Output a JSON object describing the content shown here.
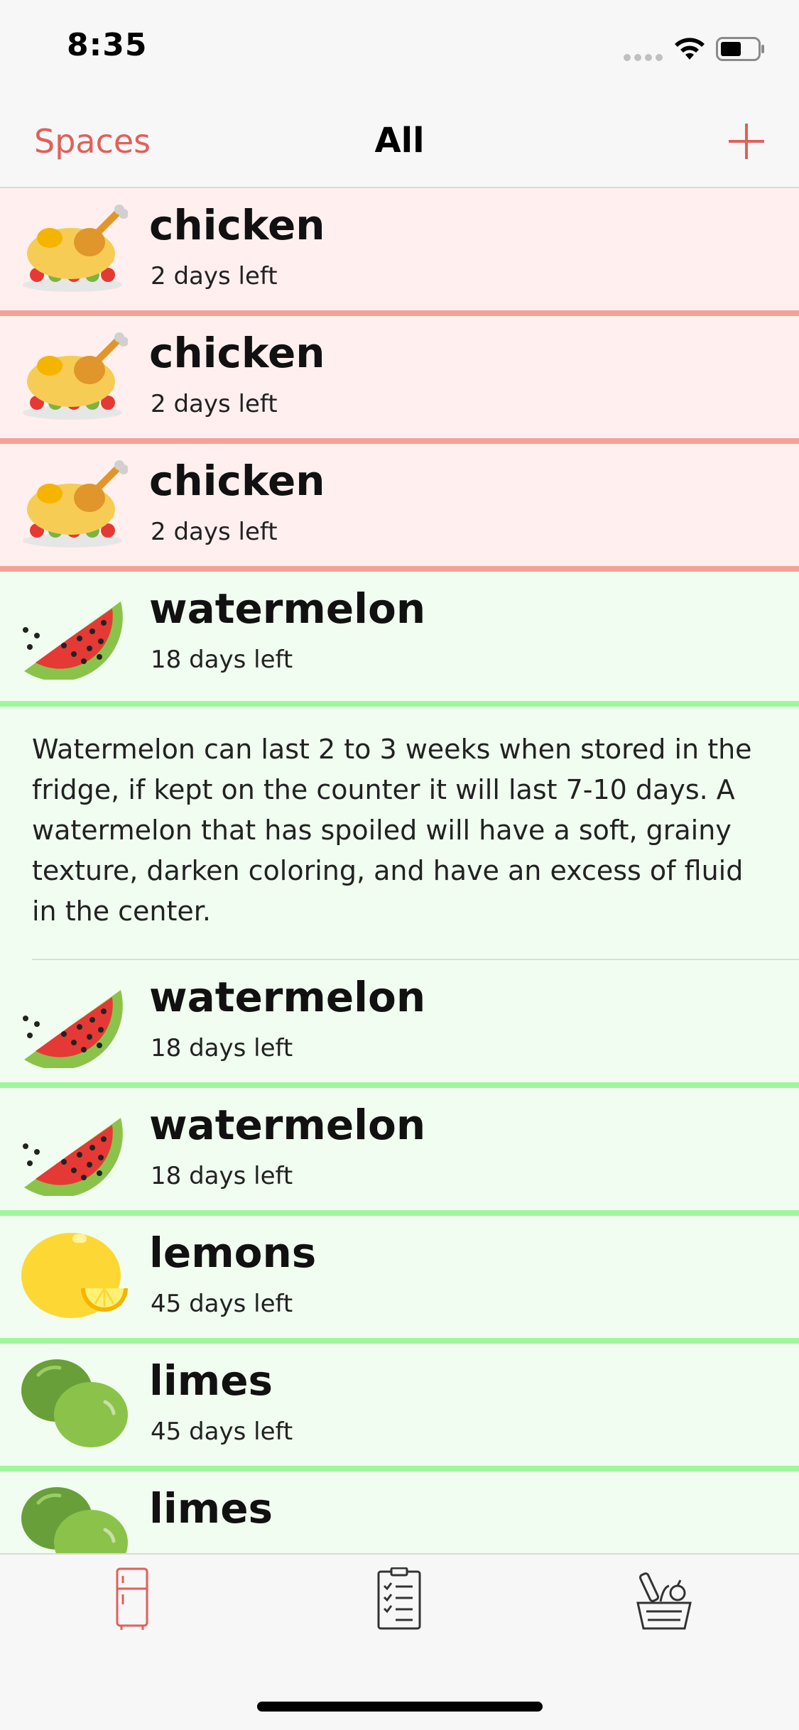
{
  "status_bar": {
    "time": "8:35"
  },
  "nav": {
    "left_label": "Spaces",
    "title": "All",
    "add_icon": "plus-icon"
  },
  "items": [
    {
      "name": "chicken",
      "days": "2 days left",
      "icon": "chicken-icon",
      "status": "expiring",
      "color": "#f5a296"
    },
    {
      "name": "chicken",
      "days": "2 days left",
      "icon": "chicken-icon",
      "status": "expiring",
      "color": "#f5a296"
    },
    {
      "name": "chicken",
      "days": "2 days left",
      "icon": "chicken-icon",
      "status": "expiring",
      "color": "#f5a296"
    },
    {
      "name": "watermelon",
      "days": "18 days left",
      "icon": "watermelon-icon",
      "status": "fresh",
      "color": "#9ef79a"
    },
    {
      "name": "watermelon",
      "days": "18 days left",
      "icon": "watermelon-icon",
      "status": "fresh",
      "color": "#9ef79a"
    },
    {
      "name": "watermelon",
      "days": "18 days left",
      "icon": "watermelon-icon",
      "status": "fresh",
      "color": "#9ef79a"
    },
    {
      "name": "lemons",
      "days": "45 days left",
      "icon": "lemon-icon",
      "status": "fresh",
      "color": "#9ef79a"
    },
    {
      "name": "limes",
      "days": "45 days left",
      "icon": "lime-icon",
      "status": "fresh",
      "color": "#9ef79a"
    },
    {
      "name": "limes",
      "days": "",
      "icon": "lime-icon",
      "status": "fresh",
      "color": "#9ef79a"
    }
  ],
  "detail": {
    "text": "Watermelon can last 2 to 3 weeks when stored in the fridge, if kept on the counter it will last 7-10 days.  A watermelon that has spoiled will have a soft, grainy texture, darken coloring, and have an excess of fluid in the center."
  },
  "tabs": [
    {
      "icon": "fridge-icon",
      "selected": true
    },
    {
      "icon": "checklist-icon",
      "selected": false
    },
    {
      "icon": "grocery-basket-icon",
      "selected": false
    }
  ],
  "colors": {
    "accent": "#e0605a",
    "expiring_bg": "#fff0ef",
    "fresh_bg": "#f1fdf0"
  }
}
